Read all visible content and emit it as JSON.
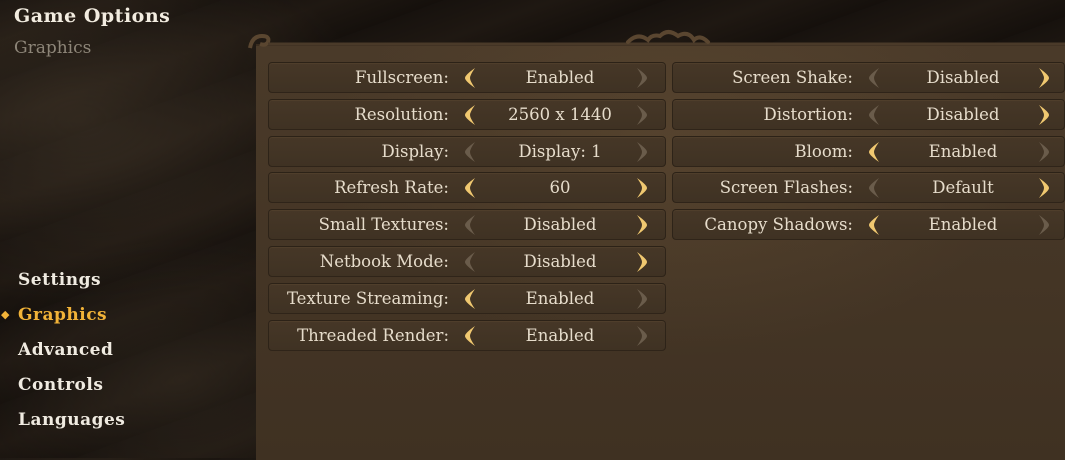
{
  "header": {
    "title": "Game Options",
    "subtitle": "Graphics"
  },
  "nav": {
    "items": [
      {
        "label": "Settings",
        "active": false
      },
      {
        "label": "Graphics",
        "active": true
      },
      {
        "label": "Advanced",
        "active": false
      },
      {
        "label": "Controls",
        "active": false
      },
      {
        "label": "Languages",
        "active": false
      }
    ]
  },
  "left_options": [
    {
      "label": "Fullscreen:",
      "value": "Enabled",
      "left_enabled": true,
      "right_enabled": false
    },
    {
      "label": "Resolution:",
      "value": "2560 x 1440",
      "left_enabled": true,
      "right_enabled": false
    },
    {
      "label": "Display:",
      "value": "Display: 1",
      "left_enabled": false,
      "right_enabled": false
    },
    {
      "label": "Refresh Rate:",
      "value": "60",
      "left_enabled": true,
      "right_enabled": true
    },
    {
      "label": "Small Textures:",
      "value": "Disabled",
      "left_enabled": false,
      "right_enabled": true
    },
    {
      "label": "Netbook Mode:",
      "value": "Disabled",
      "left_enabled": false,
      "right_enabled": true
    },
    {
      "label": "Texture Streaming:",
      "value": "Enabled",
      "left_enabled": true,
      "right_enabled": false
    },
    {
      "label": "Threaded Render:",
      "value": "Enabled",
      "left_enabled": true,
      "right_enabled": false
    }
  ],
  "right_options": [
    {
      "label": "Screen Shake:",
      "value": "Disabled",
      "left_enabled": false,
      "right_enabled": true
    },
    {
      "label": "Distortion:",
      "value": "Disabled",
      "left_enabled": false,
      "right_enabled": true
    },
    {
      "label": "Bloom:",
      "value": "Enabled",
      "left_enabled": true,
      "right_enabled": false
    },
    {
      "label": "Screen Flashes:",
      "value": "Default",
      "left_enabled": false,
      "right_enabled": true
    },
    {
      "label": "Canopy Shadows:",
      "value": "Enabled",
      "left_enabled": true,
      "right_enabled": false
    }
  ],
  "colors": {
    "accent": "#f2b338",
    "arrow_active": "#f0c870",
    "arrow_inactive": "#6a5c4b",
    "text": "#e6dccb"
  },
  "icons": {
    "left_arrow": "chevron-left-icon",
    "right_arrow": "chevron-right-icon",
    "active_marker": "diamond-icon"
  }
}
